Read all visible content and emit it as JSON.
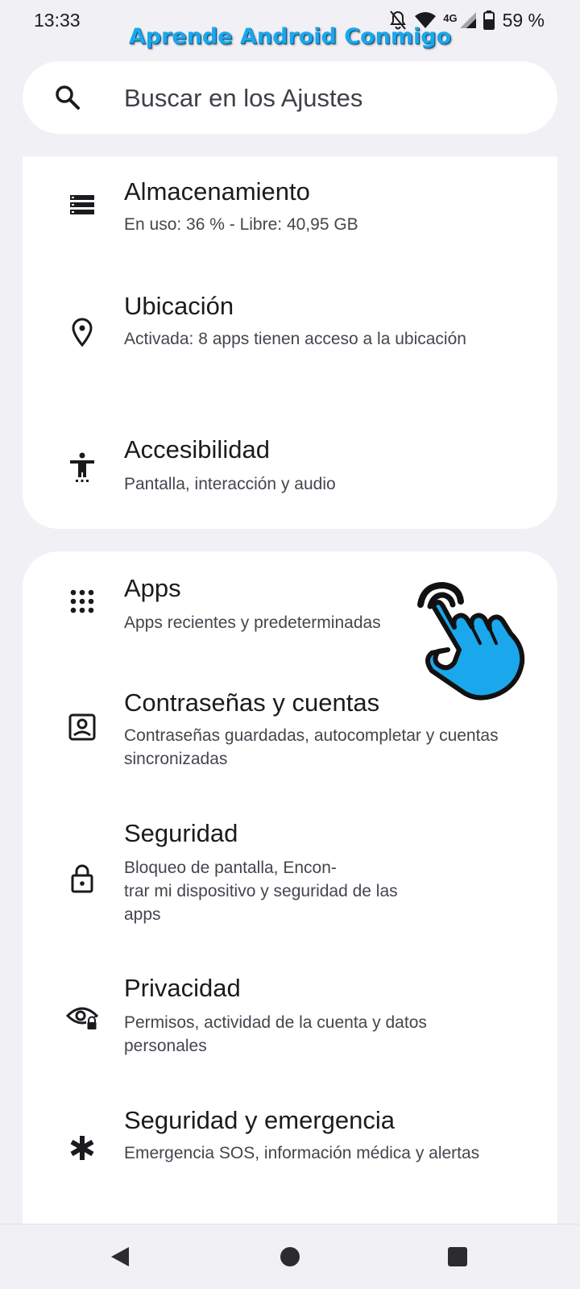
{
  "status_bar": {
    "time": "13:33",
    "network": "4G",
    "battery": "59 %",
    "icons": [
      "notifications-off-icon",
      "wifi-icon",
      "cell-signal-icon",
      "battery-icon"
    ]
  },
  "watermark": "Aprende Android Conmigo",
  "search": {
    "placeholder": "Buscar en los Ajustes",
    "icon": "search-icon"
  },
  "card_1": {
    "items": [
      {
        "title": "Almacenamiento",
        "subtitle": "En uso: 36 % - Libre: 40,95 GB",
        "icon": "storage-icon"
      },
      {
        "title": "Ubicación",
        "subtitle": "Activada: 8 apps tienen acceso a la ubicación",
        "icon": "location-pin-icon"
      },
      {
        "title": "Accesibilidad",
        "subtitle": "Pantalla, interacción y audio",
        "icon": "accessibility-icon"
      }
    ]
  },
  "card_2": {
    "items": [
      {
        "title": "Apps",
        "subtitle": "Apps recientes y predeterminadas",
        "icon": "apps-grid-icon"
      },
      {
        "title": "Contraseñas y cuentas",
        "subtitle": "Contraseñas guardadas, autocompletar y cuentas sincronizadas",
        "icon": "account-box-icon"
      },
      {
        "title": "Seguridad",
        "subtitle_lines": [
          "Bloqueo de pantalla, Encon-",
          "trar mi dispositivo y seguridad de las",
          "apps"
        ],
        "icon": "lock-icon"
      },
      {
        "title": "Privacidad",
        "subtitle": "Permisos, actividad de la cuenta y datos personales",
        "icon": "privacy-eye-lock-icon"
      },
      {
        "title": "Seguridad y emergencia",
        "subtitle": "Emergencia SOS, información médica y alertas",
        "icon": "emergency-asterisk-icon"
      }
    ]
  },
  "nav": {
    "icons": [
      "back-icon",
      "home-icon",
      "recents-icon"
    ]
  },
  "colors": {
    "background": "#f0f0f5",
    "card": "#ffffff",
    "watermark": "#1aa7ec",
    "hand_pointer": "#1aa7ec"
  }
}
